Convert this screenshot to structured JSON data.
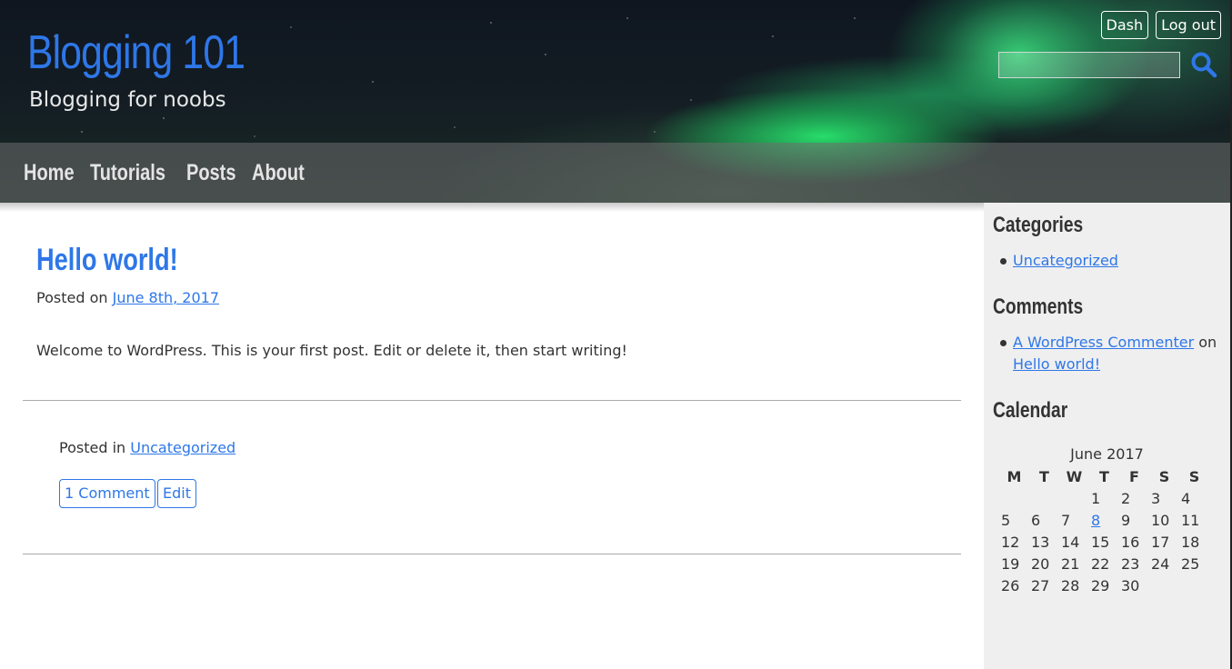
{
  "site": {
    "title": "Blogging 101",
    "tagline": "Blogging for noobs"
  },
  "admin": {
    "dash_label": "Dash",
    "logout_label": "Log out"
  },
  "search": {
    "value": "",
    "placeholder": "",
    "icon": "search-icon"
  },
  "nav": {
    "items": [
      {
        "label": "Home"
      },
      {
        "label": "Tutorials"
      },
      {
        "label": "Posts"
      },
      {
        "label": "About"
      }
    ]
  },
  "post": {
    "title": "Hello world!",
    "posted_on_prefix": "Posted on",
    "date": "June 8th, 2017",
    "body": "Welcome to WordPress. This is your first post. Edit or delete it, then start writing!",
    "posted_in_prefix": "Posted in",
    "category": "Uncategorized",
    "comments_label": "1 Comment",
    "edit_label": "Edit"
  },
  "sidebar": {
    "categories_heading": "Categories",
    "categories": [
      "Uncategorized"
    ],
    "comments_heading": "Comments",
    "recent_comment": {
      "author": "A WordPress Commenter",
      "on": "on",
      "post": "Hello world!"
    },
    "calendar_heading": "Calendar",
    "calendar": {
      "caption": "June 2017",
      "weekdays": [
        "M",
        "T",
        "W",
        "T",
        "F",
        "S",
        "S"
      ],
      "first_weekday_index": 3,
      "days_in_month": 30,
      "linked_day": 8
    }
  },
  "colors": {
    "accent": "#2e77e8",
    "text": "#333333",
    "sidebar_bg": "#efefef"
  }
}
